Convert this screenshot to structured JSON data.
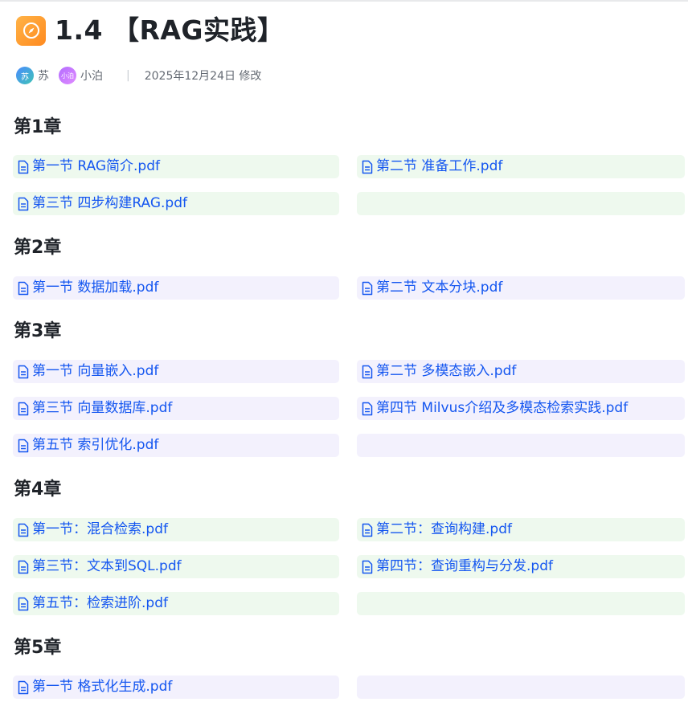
{
  "title": "1.4 【RAG实践】",
  "title_icon": "compass-icon",
  "authors": [
    {
      "avatar_text": "苏",
      "name": "苏"
    },
    {
      "avatar_text": "小泊",
      "name": "小泊"
    }
  ],
  "separator": "|",
  "modified": "2025年12月24日 修改",
  "colors": {
    "link": "#1456f0",
    "green_bg": "#eef9ee",
    "purple_bg": "#f3f1fd",
    "icon_orange": "#ff9a2e"
  },
  "chapters": [
    {
      "title": "第1章",
      "files": [
        "第一节 RAG简介.pdf",
        "第二节 准备工作.pdf",
        "第三节 四步构建RAG.pdf"
      ]
    },
    {
      "title": "第2章",
      "files": [
        "第一节 数据加载.pdf",
        "第二节 文本分块.pdf"
      ]
    },
    {
      "title": "第3章",
      "files": [
        "第一节 向量嵌入.pdf",
        "第二节 多模态嵌入.pdf",
        "第三节 向量数据库.pdf",
        "第四节 Milvus介绍及多模态检索实践.pdf",
        "第五节 索引优化.pdf"
      ]
    },
    {
      "title": "第4章",
      "files": [
        "第一节：混合检索.pdf",
        "第二节：查询构建.pdf",
        "第三节：文本到SQL.pdf",
        "第四节：查询重构与分发.pdf",
        "第五节：检索进阶.pdf"
      ]
    },
    {
      "title": "第5章",
      "files": [
        "第一节 格式化生成.pdf"
      ]
    }
  ]
}
